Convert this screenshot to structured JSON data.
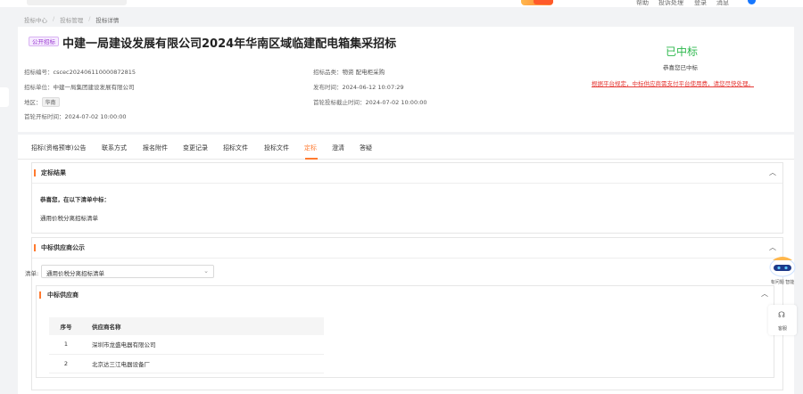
{
  "topbar": {
    "nav": [
      "帮助",
      "投诉处理",
      "登录",
      "消息"
    ]
  },
  "breadcrumb": [
    "投标中心",
    "投标管理",
    "投标详情"
  ],
  "header": {
    "tag": "公开招标",
    "title": "中建一局建设发展有限公司2024年华南区域临建配电箱集采招标",
    "left_info": [
      {
        "label": "招标编号：",
        "value": "cscec202406110000872815"
      },
      {
        "label": "招标单位：",
        "value": "中建一局集团建设发展有限公司"
      },
      {
        "label": "地区：",
        "value": "华南"
      },
      {
        "label": "首轮开标时间：",
        "value": "2024-07-02 10:00:00"
      }
    ],
    "mid_info": [
      {
        "label": "招标品类：",
        "value": "物资 配电柜采购"
      },
      {
        "label": "发布时间：",
        "value": "2024-06-12 10:07:29"
      },
      {
        "label": "首轮投标截止时间：",
        "value": "2024-07-02 10:00:00"
      }
    ],
    "status": "已中标",
    "status_sub": "恭喜您已中标",
    "status_warning": "根据平台规定，中标供应商需支付平台使用费，请您尽快处理。"
  },
  "tabs": [
    "招标(资格预审)公告",
    "联系方式",
    "报名附件",
    "变更记录",
    "招标文件",
    "投标文件",
    "定标",
    "澄清",
    "答疑"
  ],
  "active_tab": "定标",
  "result": {
    "title": "定标结果",
    "congrats": "恭喜您，在以下清单中标：",
    "list_name": "通用价税分离招标清单"
  },
  "suppliers_section": {
    "title": "中标供应商公示",
    "list_label": "清单:",
    "list_value": "通用价税分离招标清单",
    "sub_title": "中标供应商",
    "columns": [
      "序号",
      "供应商名称"
    ],
    "rows": [
      [
        "1",
        "深圳市龙盛电器有限公司"
      ],
      [
        "2",
        "北京达三江电器设备厂"
      ]
    ]
  },
  "float": {
    "bot_label": "有问题 智能",
    "help_label": "客服"
  },
  "colors": {
    "accent": "#ff7a2f",
    "success": "#2db84d",
    "danger": "#e53935",
    "tag_purple": "#9b3bd1"
  }
}
